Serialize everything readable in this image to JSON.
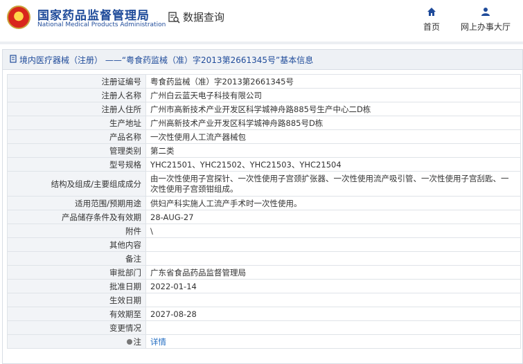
{
  "header": {
    "brand_cn": "国家药品监督管理局",
    "brand_en": "National Medical Products Administration",
    "search_tab": "数据查询",
    "nav": [
      {
        "label": "首页",
        "icon": "home-icon"
      },
      {
        "label": "网上办事大厅",
        "icon": "user-icon"
      }
    ]
  },
  "panel": {
    "title": "境内医疗器械（注册） ——“粤食药监械（准）字2013第2661345号”基本信息"
  },
  "rows": [
    {
      "label": "注册证编号",
      "value": "粤食药监械（准）字2013第2661345号"
    },
    {
      "label": "注册人名称",
      "value": "广州白云蓝天电子科技有限公司"
    },
    {
      "label": "注册人住所",
      "value": "广州市高新技术产业开发区科学城神舟路885号生产中心二D栋"
    },
    {
      "label": "生产地址",
      "value": "广州高新技术产业开发区科学城神舟路885号D栋"
    },
    {
      "label": "产品名称",
      "value": "一次性使用人工流产器械包"
    },
    {
      "label": "管理类别",
      "value": "第二类"
    },
    {
      "label": "型号规格",
      "value": "YHC21501、YHC21502、YHC21503、YHC21504"
    },
    {
      "label": "结构及组成/主要组成成分",
      "value": "由一次性使用子宫探针、一次性使用子宫颈扩张器、一次性使用流产吸引管、一次性使用子宫刮匙、一次性使用子宫颈钳组成。"
    },
    {
      "label": "适用范围/预期用途",
      "value": "供妇产科实施人工流产手术时一次性使用。"
    },
    {
      "label": "产品储存条件及有效期",
      "value": "28-AUG-27"
    },
    {
      "label": "附件",
      "value": "\\"
    },
    {
      "label": "其他内容",
      "value": ""
    },
    {
      "label": "备注",
      "value": ""
    },
    {
      "label": "审批部门",
      "value": "广东省食品药品监督管理局"
    },
    {
      "label": "批准日期",
      "value": "2022-01-14"
    },
    {
      "label": "生效日期",
      "value": ""
    },
    {
      "label": "有效期至",
      "value": "2027-08-28"
    },
    {
      "label": "变更情况",
      "value": ""
    },
    {
      "label": "注",
      "value": "详情"
    }
  ]
}
